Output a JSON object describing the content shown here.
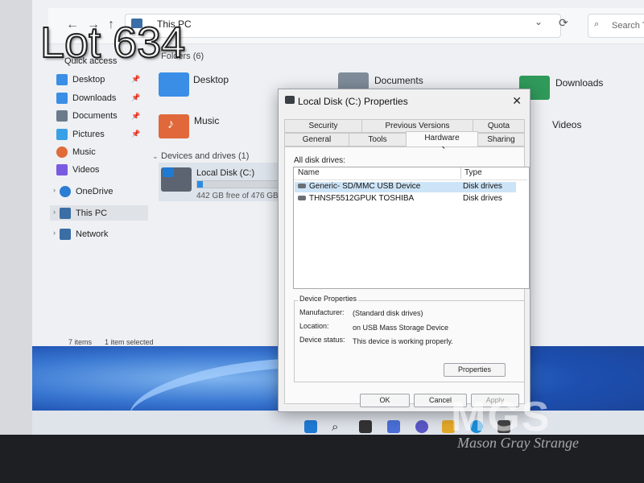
{
  "overlay": {
    "lot": "Lot 634"
  },
  "explorer": {
    "path": "This PC",
    "search_placeholder": "Search T",
    "quick_access_header": "Quick access",
    "sidebar": [
      {
        "label": "Desktop",
        "color": "#3a8ee6"
      },
      {
        "label": "Downloads",
        "color": "#3a8ee6"
      },
      {
        "label": "Documents",
        "color": "#6b7b8c"
      },
      {
        "label": "Pictures",
        "color": "#3aa0e6"
      },
      {
        "label": "Music",
        "color": "#e06a3a"
      },
      {
        "label": "Videos",
        "color": "#7a5ae0"
      },
      {
        "label": "OneDrive",
        "color": "#2b7cd3"
      },
      {
        "label": "This PC",
        "color": "#3a6ea5"
      },
      {
        "label": "Network",
        "color": "#3a6ea5"
      }
    ],
    "folders_header": "Folders (6)",
    "folders": [
      {
        "label": "Desktop"
      },
      {
        "label": "Documents"
      },
      {
        "label": "Downloads"
      },
      {
        "label": "Music"
      },
      {
        "label": "Videos"
      }
    ],
    "drives_header": "Devices and drives (1)",
    "drive": {
      "name": "Local Disk (C:)",
      "free": "442 GB free of 476 GB",
      "used_fraction": 0.07
    },
    "status_items": "7 items",
    "status_selected": "1 item selected"
  },
  "dialog": {
    "title": "Local Disk (C:) Properties",
    "tabs_row1": [
      "Security",
      "Previous Versions",
      "Quota"
    ],
    "tabs_row2": [
      "General",
      "Tools",
      "Hardware",
      "Sharing"
    ],
    "active_tab": "Hardware",
    "list_label": "All disk drives:",
    "columns": [
      "Name",
      "Type"
    ],
    "rows": [
      {
        "name": "Generic- SD/MMC USB Device",
        "type": "Disk drives"
      },
      {
        "name": "THNSF5512GPUK TOSHIBA",
        "type": "Disk drives"
      }
    ],
    "device_props_header": "Device Properties",
    "props": [
      {
        "label": "Manufacturer:",
        "value": "(Standard disk drives)"
      },
      {
        "label": "Location:",
        "value": "on USB Mass Storage Device"
      },
      {
        "label": "Device status:",
        "value": "This device is working properly."
      }
    ],
    "properties_button": "Properties",
    "ok": "OK",
    "cancel": "Cancel",
    "apply": "Apply"
  },
  "watermark": {
    "logo": "MGS",
    "text": "Mason Gray Strange"
  }
}
